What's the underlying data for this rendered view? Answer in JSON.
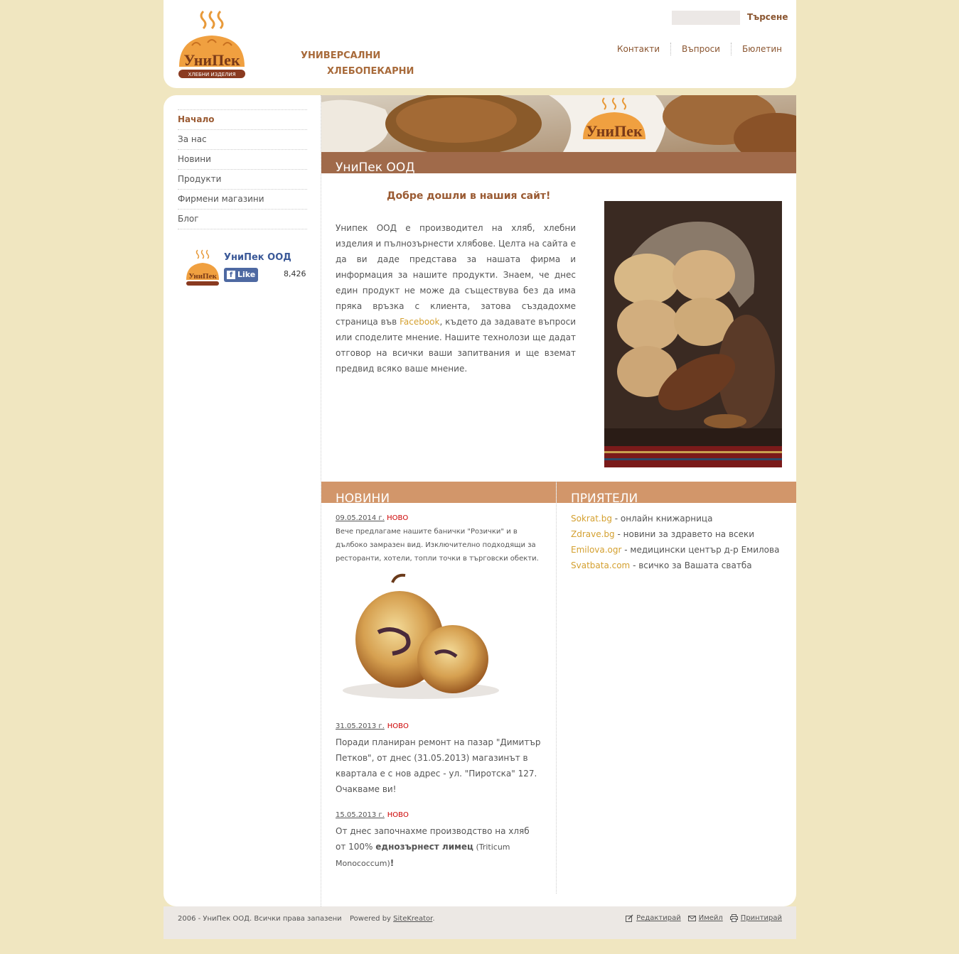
{
  "header": {
    "brand_text": "УниПек",
    "brand_subtext": "ХЛЕБНИ ИЗДЕЛИЯ",
    "tagline_line1": "УНИВЕРСАЛНИ",
    "tagline_line2": "ХЛЕБОПЕКАРНИ",
    "search_placeholder": "",
    "search_button": "Търсене",
    "nav": [
      "Контакти",
      "Въпроси",
      "Бюлетин"
    ]
  },
  "sidebar": {
    "items": [
      "Начало",
      "За нас",
      "Новини",
      "Продукти",
      "Фирмени магазини",
      "Блог"
    ],
    "active_index": 0
  },
  "facebook": {
    "page_name": "УниПек ООД",
    "like_label": "Like",
    "like_count": "8,426"
  },
  "banner": {
    "title": "УниПек ООД",
    "logo_text": "УниПек"
  },
  "intro": {
    "heading": "Добре дошли в нашия сайт!",
    "text_before": "Унипек ООД е производител на хляб, хлебни изделия и пълнозърнести хлябове. Целта на сайта е да ви даде представа за нашата фирма и информация за нашите продукти. Знаем, че днес един продукт не може да съществува без да има пряка връзка с клиента, затова създадохме страница във ",
    "facebook_link": "Facebook",
    "text_after": ", където да задавате въпроси или споделите мнение. Нашите технолози ще дадат отговор на всички ваши запитвания и ще вземат предвид всяко ваше мнение."
  },
  "news": {
    "title": "НОВИНИ",
    "items": [
      {
        "date": "09.05.2014 г.",
        "badge": "НОВО",
        "text": "Вече предлагаме нашите банички \"Розички\" и в дълбоко замразен вид. Изключително подходящи за ресторанти, хотели, топли точки в търговски обекти."
      },
      {
        "date": "31.05.2013 г.",
        "badge": "НОВО",
        "text": "Поради планиран ремонт на пазар \"Димитър Петков\", от днес (31.05.2013) магазинът в квартала е с нов адрес - ул. \"Пиротска\" 127. Очакваме ви!"
      },
      {
        "date": "15.05.2013 г.",
        "badge": "НОВО",
        "text_before": "От днес започнахме производство на хляб от 100% ",
        "bold": "еднозърнест лимец",
        "text_after": " (Triticum Monococcum)",
        "end": "!"
      }
    ]
  },
  "friends": {
    "title": "ПРИЯТЕЛИ",
    "items": [
      {
        "name": "Sokrat.bg",
        "desc": " - онлайн книжарница"
      },
      {
        "name": "Zdrave.bg",
        "desc": " - новини за здравето на всеки"
      },
      {
        "name": "Emilova.ogr",
        "desc": " - медицински център д-р Емилова"
      },
      {
        "name": "Svatbata.com",
        "desc": " - всичко за Вашата сватба"
      }
    ]
  },
  "footer": {
    "copyright": "2006 - УниПек ООД. Всички права запазени",
    "powered_prefix": "Powered by ",
    "powered_link": "SiteKreator",
    "powered_suffix": ".",
    "links": [
      "Редактирай",
      "Имейл",
      "Принтирай"
    ]
  },
  "colors": {
    "page_bg": "#f0e6c0",
    "accent_brown": "#9a5a32",
    "banner_bar": "#a06a4a",
    "section_bar": "#d2966a",
    "link_gold": "#d4a030",
    "badge_red": "#cc0000"
  }
}
